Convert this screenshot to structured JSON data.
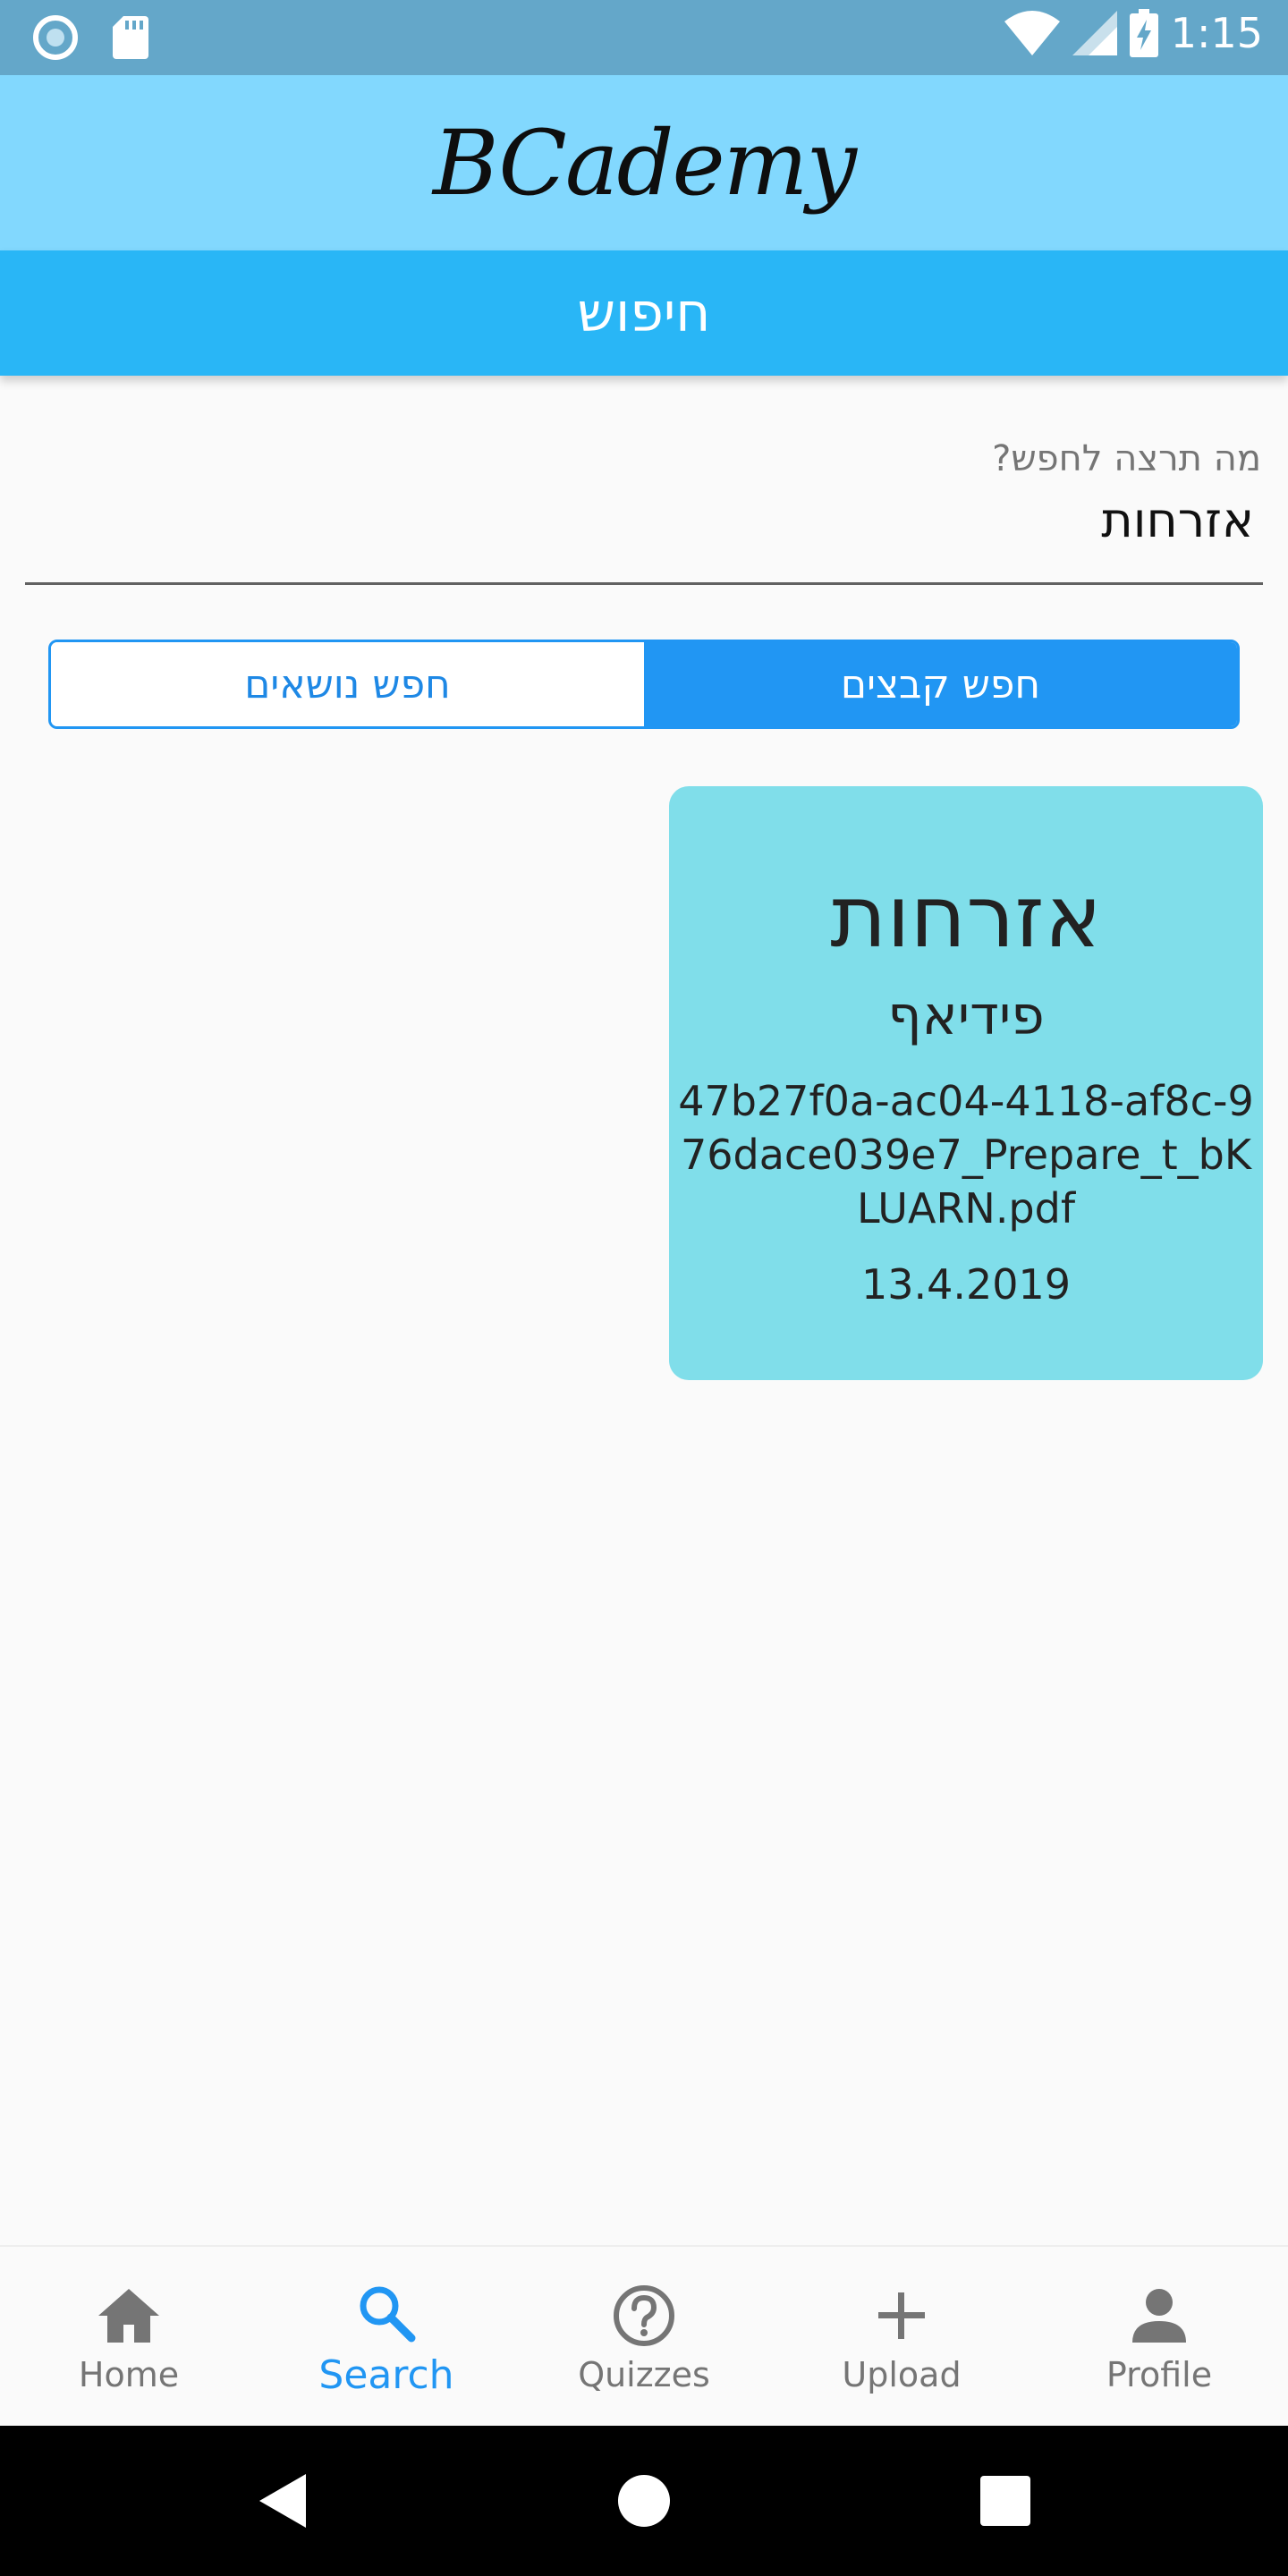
{
  "status_bar": {
    "time": "1:15",
    "icons": [
      "radio-icon",
      "sd-card-icon",
      "wifi-icon",
      "signal-icon",
      "battery-charging-icon"
    ]
  },
  "app_bar": {
    "brand": "BCademy"
  },
  "title_bar": {
    "title": "חיפוש"
  },
  "search": {
    "label": "מה תרצה לחפש?",
    "value": "אזרחות"
  },
  "toggle": {
    "search_topics": "חפש נושאים",
    "search_files": "חפש קבצים",
    "selected": "search_files"
  },
  "colors": {
    "accent": "#2196f3",
    "app_bar": "#82d8fe",
    "title_bar": "#29b6f6",
    "card": "#80deea",
    "status_bar": "#64a7c9"
  },
  "results": [
    {
      "title": "אזרחות",
      "type": "פידיאף",
      "filename": "47b27f0a-ac04-4118-af8c-976dace039e7_Prepare_t_bKLUARN.pdf",
      "date": "13.4.2019"
    }
  ],
  "bottom_nav": {
    "active": "search",
    "items": [
      {
        "label": "Home",
        "icon": "home-icon"
      },
      {
        "label": "Search",
        "icon": "search-icon"
      },
      {
        "label": "Quizzes",
        "icon": "help-circle-icon"
      },
      {
        "label": "Upload",
        "icon": "plus-icon"
      },
      {
        "label": "Profile",
        "icon": "person-icon"
      }
    ]
  },
  "system_nav": {
    "icons": [
      "back-icon",
      "home-circle-icon",
      "recents-icon"
    ]
  }
}
